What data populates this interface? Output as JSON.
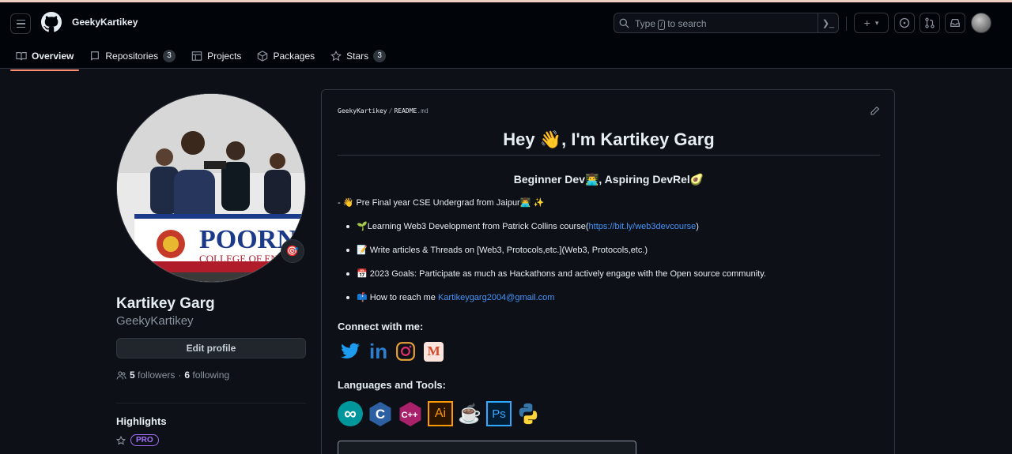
{
  "header": {
    "username": "GeekyKartikey",
    "search_prefix": "Type ",
    "search_slash": "/",
    "search_suffix": " to search",
    "command_glyph": "❯_",
    "plus_label": "+",
    "caret": "▾"
  },
  "tabs": [
    {
      "label": "Overview",
      "icon": "book-icon"
    },
    {
      "label": "Repositories",
      "count": "3",
      "icon": "repo-icon"
    },
    {
      "label": "Projects",
      "icon": "table-icon"
    },
    {
      "label": "Packages",
      "icon": "package-icon"
    },
    {
      "label": "Stars",
      "count": "3",
      "icon": "star-icon"
    }
  ],
  "profile": {
    "full_name": "Kartikey Garg",
    "login": "GeekyKartikey",
    "edit_label": "Edit profile",
    "followers_count": "5",
    "followers_label": "followers",
    "dot": "·",
    "following_count": "6",
    "following_label": "following",
    "highlights_title": "Highlights",
    "pro_badge": "PRO",
    "photo_banner_text": "POORNI",
    "photo_banner_sub": "COLLEGE OF EN",
    "status_emoji": "🎯"
  },
  "readme": {
    "owner": "GeekyKartikey",
    "sep": "/",
    "file_name": "README",
    "file_ext": ".md",
    "title": "Hey 👋, I'm Kartikey Garg",
    "subtitle": "Beginner Dev👨‍💻, Aspiring DevRel🥑",
    "intro": "- 👋 Pre Final year CSE Undergrad from Jaipur👨‍💻 ✨",
    "bullets": [
      {
        "text": "🌱Learning Web3 Development from Patrick Collins course(",
        "link": "https://bit.ly/web3devcourse",
        "after": ")"
      },
      {
        "text": "📝 Write articles & Threads on [Web3, Protocols,etc.](Web3, Protocols,etc.)",
        "link": "",
        "after": ""
      },
      {
        "text": "📅 2023 Goals: Participate as much as Hackathons and actively engage with the Open source community.",
        "link": "",
        "after": ""
      },
      {
        "text": "📫 How to reach me ",
        "link": "Kartikeygarg2004@gmail.com",
        "after": ""
      }
    ],
    "connect_title": "Connect with me:",
    "languages_title": "Languages and Tools:",
    "social": [
      "twitter-icon",
      "linkedin-icon",
      "instagram-icon",
      "medium-icon"
    ],
    "tools": [
      "arduino-icon",
      "c-icon",
      "cplusplus-icon",
      "illustrator-icon",
      "java-icon",
      "photoshop-icon",
      "python-icon"
    ],
    "linkedin_text": "in",
    "medium_text": "M",
    "c_text": "C",
    "cpp_text": "C++",
    "ai_text": "Ai",
    "ps_text": "Ps",
    "arduino_text": "∞",
    "java_text": "☕"
  },
  "colors": {
    "accent_tab": "#fd8c73",
    "link": "#4493f8",
    "pro": "#a371f7"
  }
}
